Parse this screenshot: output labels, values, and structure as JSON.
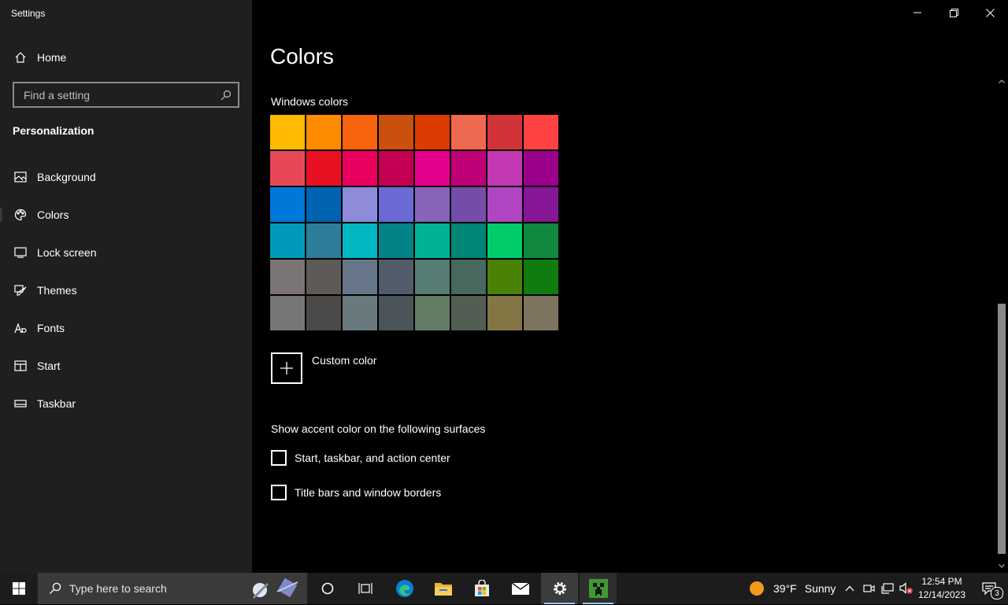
{
  "window": {
    "title": "Settings",
    "minimize_icon": "minimize-icon",
    "maximize_icon": "restore-icon",
    "close_icon": "close-icon"
  },
  "sidebar": {
    "home_label": "Home",
    "search_placeholder": "Find a setting",
    "section": "Personalization",
    "items": [
      {
        "label": "Background",
        "icon": "image-icon"
      },
      {
        "label": "Colors",
        "icon": "palette-icon",
        "selected": true
      },
      {
        "label": "Lock screen",
        "icon": "lock-screen-icon"
      },
      {
        "label": "Themes",
        "icon": "brush-icon"
      },
      {
        "label": "Fonts",
        "icon": "fonts-icon"
      },
      {
        "label": "Start",
        "icon": "start-icon"
      },
      {
        "label": "Taskbar",
        "icon": "taskbar-icon"
      }
    ]
  },
  "main": {
    "title": "Colors",
    "windows_colors_label": "Windows colors",
    "swatches": [
      "#FFB900",
      "#FF8C00",
      "#F7630C",
      "#CA5010",
      "#DA3B01",
      "#EF6950",
      "#D13438",
      "#FF4343",
      "#E74856",
      "#E81123",
      "#EA005E",
      "#C30052",
      "#E3008C",
      "#BF0077",
      "#C239B3",
      "#9A0089",
      "#0078D7",
      "#0063B1",
      "#8E8CD8",
      "#6B69D6",
      "#8764B8",
      "#744DA9",
      "#B146C2",
      "#881798",
      "#0099BC",
      "#2D7D9A",
      "#00B7C3",
      "#038387",
      "#00B294",
      "#018574",
      "#00CC6A",
      "#10893E",
      "#7A7574",
      "#5D5A58",
      "#68768A",
      "#515C6B",
      "#567C73",
      "#486860",
      "#498205",
      "#107C10",
      "#767676",
      "#4C4A48",
      "#69797E",
      "#4A5459",
      "#647C64",
      "#525E54",
      "#847545",
      "#7E735F"
    ],
    "custom_color_label": "Custom color",
    "surfaces_label": "Show accent color on the following surfaces",
    "checkboxes": [
      {
        "label": "Start, taskbar, and action center",
        "checked": false
      },
      {
        "label": "Title bars and window borders",
        "checked": false
      }
    ]
  },
  "taskbar": {
    "search_placeholder": "Type here to search",
    "weather": {
      "temp": "39°F",
      "condition": "Sunny"
    },
    "time": "12:54 PM",
    "date": "12/14/2023",
    "notification_count": "3"
  }
}
